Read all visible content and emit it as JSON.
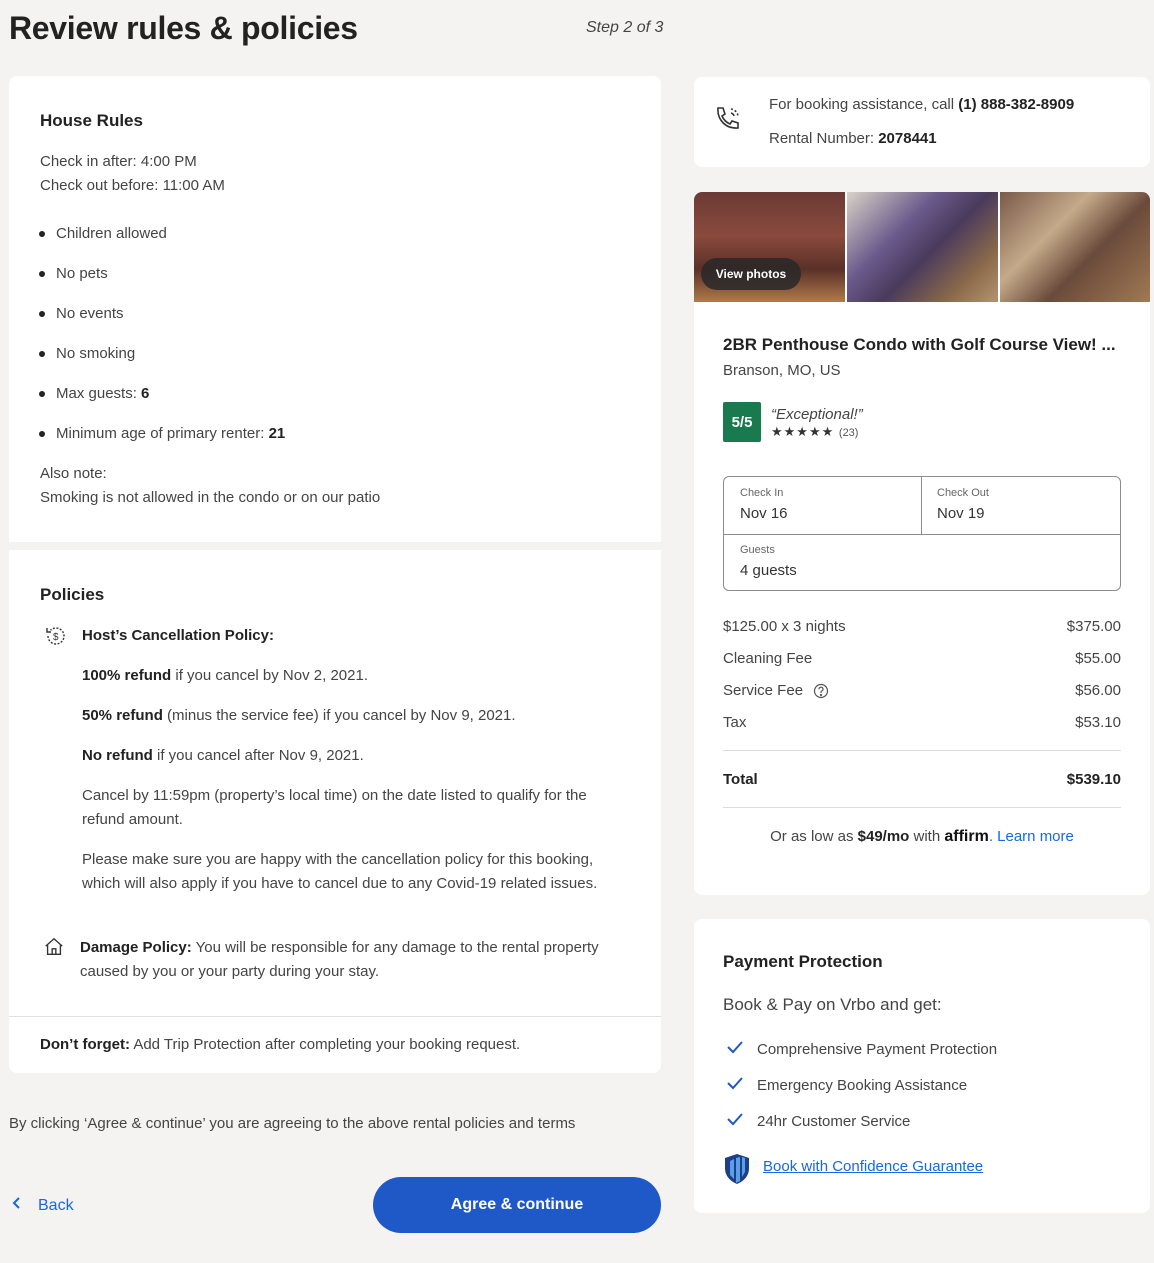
{
  "header": {
    "title": "Review rules & policies",
    "step": "Step 2 of 3"
  },
  "house_rules": {
    "title": "House Rules",
    "check_in": "Check in after: 4:00 PM",
    "check_out": "Check out before: 11:00 AM",
    "rules": [
      "Children allowed",
      "No pets",
      "No events",
      "No smoking"
    ],
    "max_guests_label": "Max guests: ",
    "max_guests_value": "6",
    "min_age_label": "Minimum age of primary renter: ",
    "min_age_value": "21",
    "also_note_label": "Also note:",
    "also_note_text": "Smoking is not allowed in the condo or on our patio"
  },
  "policies": {
    "title": "Policies",
    "cancel_title": "Host’s Cancellation Policy:",
    "full_refund_bold": "100% refund",
    "full_refund_text": " if you cancel by Nov 2, 2021.",
    "half_refund_bold": "50% refund",
    "half_refund_text": " (minus the service fee) if you cancel by Nov 9, 2021.",
    "no_refund_bold": "No refund",
    "no_refund_text": " if you cancel after Nov 9, 2021.",
    "cancel_by_line1": "Cancel by 11:59pm (property’s local time) on the date listed to qualify for the",
    "cancel_by_line2": "refund amount.",
    "covid_line1": "Please make sure you are happy with the cancellation policy for this booking,",
    "covid_line2": "which will also apply if you have to cancel due to any Covid-19 related issues.",
    "damage_bold": "Damage Policy:",
    "damage_line1": " You will be responsible for any damage to the rental property",
    "damage_line2": "caused by you or your party during your stay.",
    "forget_bold": "Don’t forget:",
    "forget_text": " Add Trip Protection after completing your booking request."
  },
  "agree_note": "By clicking ‘Agree & continue’ you are agreeing to the above rental policies and terms",
  "back_label": "Back",
  "agree_label": "Agree & continue",
  "assistance": {
    "call_text": "For booking assistance, call ",
    "phone": "(1) 888-382-8909",
    "rental_label": "Rental Number: ",
    "rental_number": "2078441"
  },
  "listing": {
    "view_photos": "View photos",
    "title": "2BR Penthouse Condo with Golf Course View! ...",
    "location": "Branson, MO, US",
    "rating": "5/5",
    "rating_text": "“Exceptional!”",
    "stars": "★★★★★",
    "review_count": "(23)",
    "check_in_label": "Check In",
    "check_in_value": "Nov 16",
    "check_out_label": "Check Out",
    "check_out_value": "Nov 19",
    "guests_label": "Guests",
    "guests_value": "4 guests",
    "prices": [
      {
        "label": "$125.00 x 3 nights",
        "value": "$375.00"
      },
      {
        "label": "Cleaning Fee",
        "value": "$55.00"
      },
      {
        "label": "Service Fee",
        "value": "$56.00"
      },
      {
        "label": "Tax",
        "value": "$53.10"
      }
    ],
    "total_label": "Total",
    "total_value": "$539.10",
    "affirm_pre": "Or as low as ",
    "affirm_amount": "$49/mo",
    "affirm_with": " with ",
    "affirm_brand": "affirm",
    "learn_more": "Learn more"
  },
  "protection": {
    "title": "Payment Protection",
    "subtitle": "Book & Pay on Vrbo and get:",
    "items": [
      "Comprehensive Payment Protection",
      "Emergency Booking Assistance",
      "24hr Customer Service"
    ],
    "guarantee_link": "Book with Confidence Guarantee"
  },
  "colors": {
    "primary": "#1f58c7",
    "link": "#1668e3",
    "rating_green": "#1a7a4f"
  }
}
